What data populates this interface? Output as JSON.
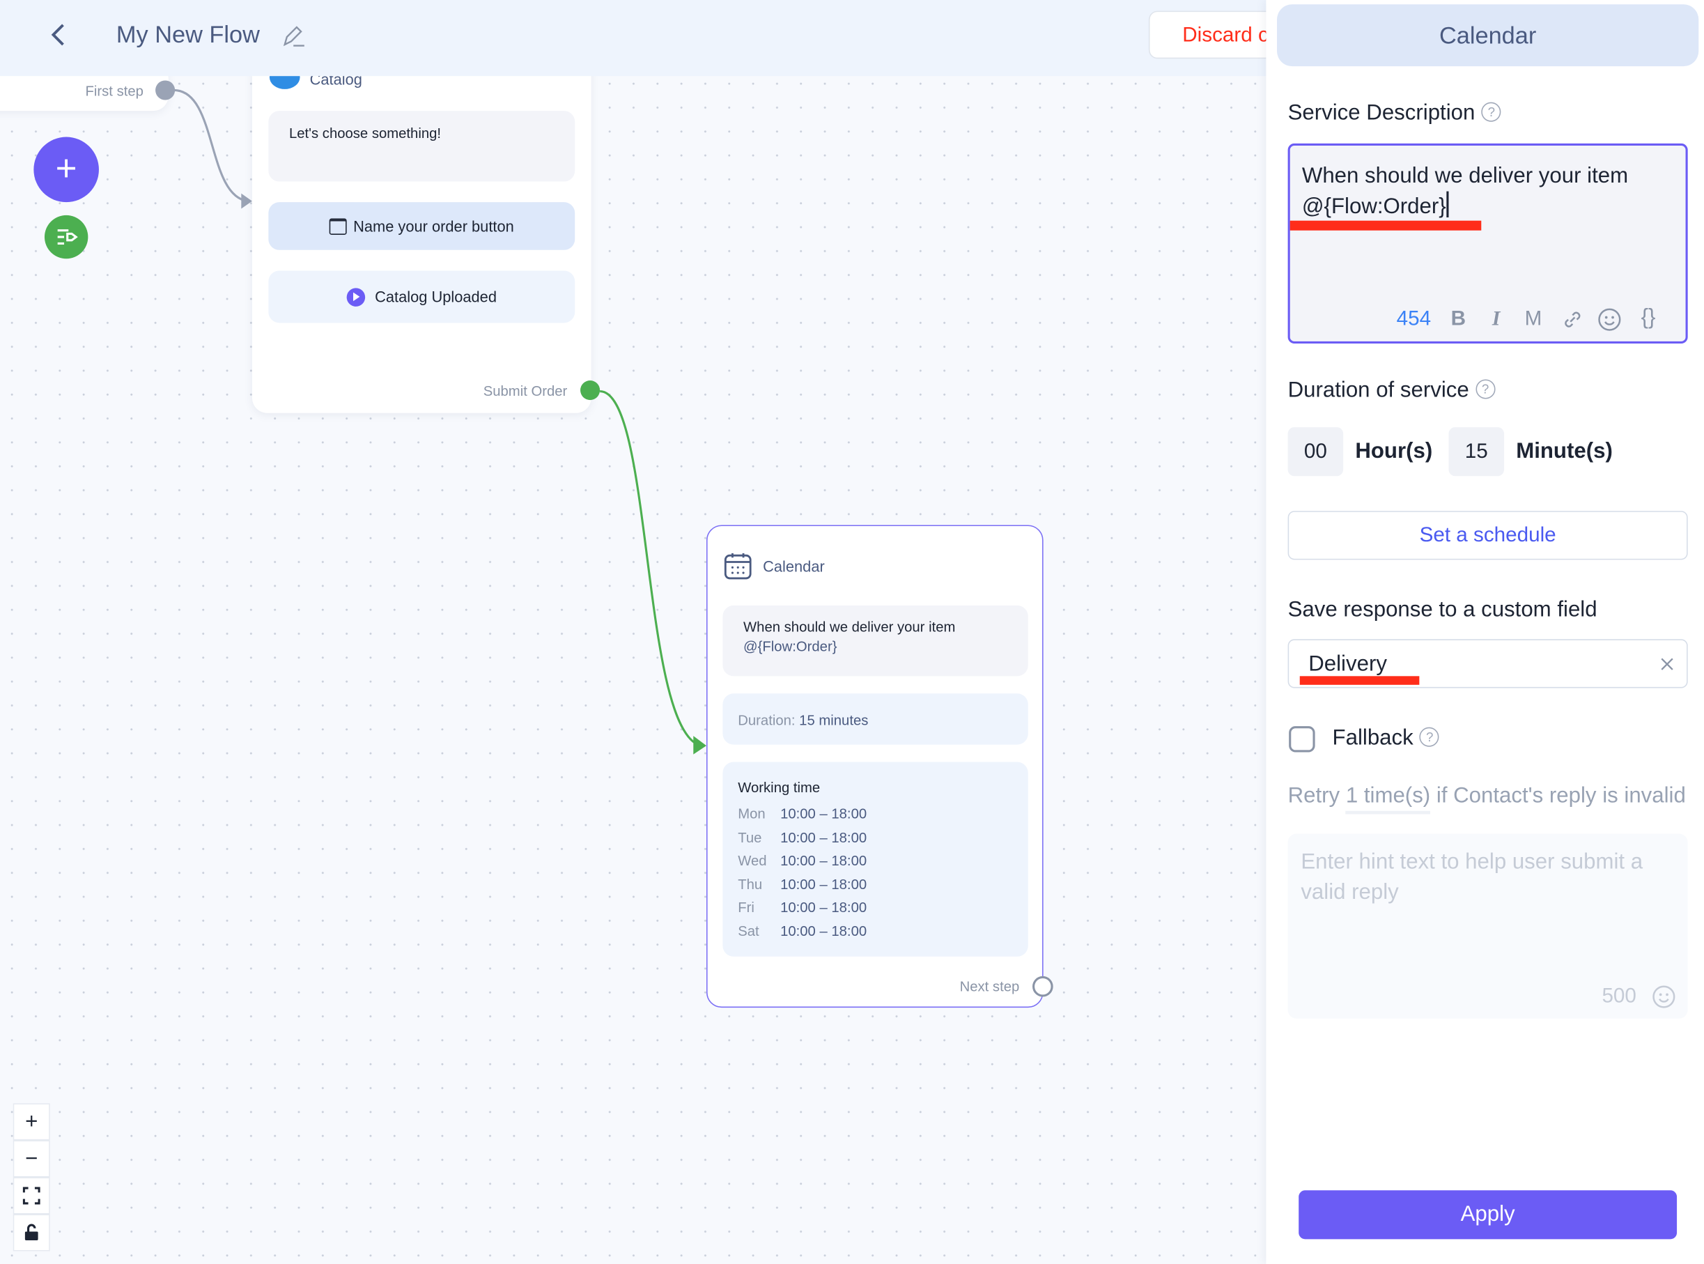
{
  "header": {
    "title": "My New Flow",
    "discard_label": "Discard changes"
  },
  "canvas": {
    "first_step": {
      "port_label": "First step"
    },
    "catalog_node": {
      "title": "Catalog",
      "message": "Let's choose something!",
      "button_label": "Name your order button",
      "catalog_label": "Catalog Uploaded",
      "port_label": "Submit Order"
    },
    "calendar_node": {
      "title": "Calendar",
      "message_line1": "When should we deliver your item",
      "message_line2": "@{Flow:Order}",
      "duration_label": "Duration:",
      "duration_value": "15 minutes",
      "working_time_title": "Working time",
      "schedule": [
        {
          "day": "Mon",
          "hours": "10:00 – 18:00"
        },
        {
          "day": "Tue",
          "hours": "10:00 – 18:00"
        },
        {
          "day": "Wed",
          "hours": "10:00 – 18:00"
        },
        {
          "day": "Thu",
          "hours": "10:00 – 18:00"
        },
        {
          "day": "Fri",
          "hours": "10:00 – 18:00"
        },
        {
          "day": "Sat",
          "hours": "10:00 – 18:00"
        }
      ],
      "port_label": "Next step"
    },
    "zoom_controls": {
      "zoom_in": "+",
      "zoom_out": "−"
    }
  },
  "panel": {
    "title": "Calendar",
    "service_description_label": "Service Description",
    "service_description_line1": "When should we deliver your item",
    "service_description_line2": "@{Flow:Order}",
    "char_count": "454",
    "toolbar": {
      "bold": "B",
      "italic": "I",
      "mono": "M",
      "variables": "{}"
    },
    "duration_label": "Duration of service",
    "hours_value": "00",
    "hours_unit": "Hour(s)",
    "minutes_value": "15",
    "minutes_unit": "Minute(s)",
    "set_schedule_label": "Set a schedule",
    "custom_field_label": "Save response to a custom field",
    "custom_field_value": "Delivery",
    "fallback_label": "Fallback",
    "retry_prefix": "Retry",
    "retry_count": "1 time(s)",
    "retry_suffix": "if Contact's reply is invalid",
    "hint_placeholder": "Enter hint text to help user submit a valid reply",
    "hint_char_count": "500",
    "apply_label": "Apply"
  },
  "colors": {
    "accent": "#6b5cf5",
    "success": "#4caf50",
    "danger": "#ff2d1a",
    "link": "#3b82f6"
  }
}
